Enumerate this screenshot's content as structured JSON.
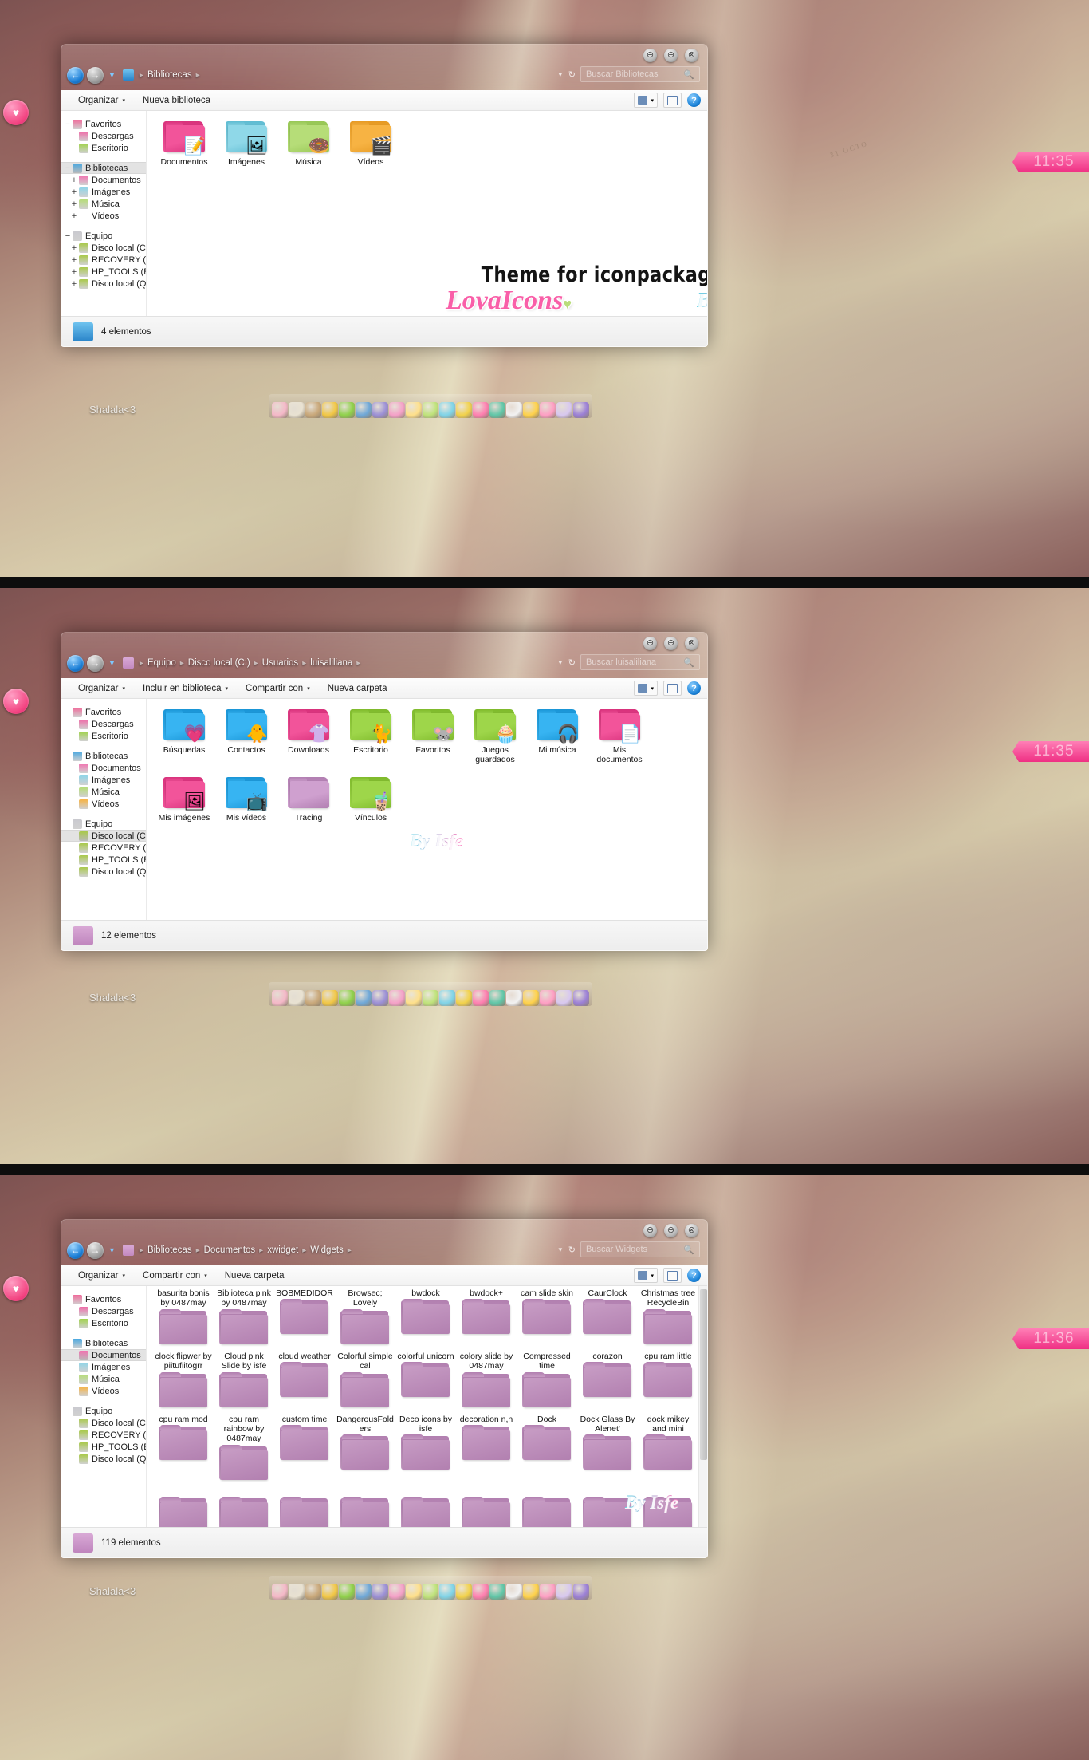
{
  "desktop": {
    "shalala_text": "Shalala<3",
    "heart_icon": "heart-icon",
    "dock_icons": [
      "cake-icon",
      "teacup-icon",
      "tea-box-icon",
      "mushroom-icon",
      "camera-icon",
      "donut-icon",
      "cactus-icon",
      "bear-icon",
      "panda-icon",
      "boot-icon",
      "ice-cream-icon",
      "heart-balloon-icon",
      "bread-icon",
      "smiley-icon",
      "photoshop-icon",
      "mickey-icon",
      "bow-icon",
      "bunny-icon",
      "ball-icon"
    ],
    "wallpaper_note": "31 OCTO"
  },
  "window1": {
    "clock": "11:35",
    "buttons": {
      "minimize": "⊖",
      "maximize": "⊖",
      "close": "⊗"
    },
    "nav": {
      "back": "←",
      "forward": "→",
      "dropdown": "▼"
    },
    "breadcrumb": [
      "Bibliotecas"
    ],
    "breadcrumb_icon": "libraries-icon",
    "search": {
      "placeholder": "Buscar Bibliotecas",
      "icon": "search-icon",
      "refresh": "↻",
      "dropdown": "▼"
    },
    "toolbar": {
      "items": [
        {
          "label": "Organizar",
          "caret": "▾"
        },
        {
          "label": "Nueva biblioteca",
          "caret": ""
        }
      ],
      "view_button": "view-layout-icon",
      "preview_button": "preview-pane-icon",
      "help_button": "?"
    },
    "sidebar": [
      {
        "label": "Favoritos",
        "level": 0,
        "twisty": "−",
        "icon": "minnie-icon",
        "color": "#f06a9a",
        "selected": false
      },
      {
        "label": "Descargas",
        "level": 1,
        "twisty": "",
        "icon": "folder-pink-icon",
        "color": "#ef6ba8",
        "selected": false
      },
      {
        "label": "Escritorio",
        "level": 1,
        "twisty": "",
        "icon": "folder-green-icon",
        "color": "#9fd24a",
        "selected": false
      },
      {
        "label": "Bibliotecas",
        "level": 0,
        "twisty": "−",
        "icon": "libraries-icon",
        "color": "#4aa8e0",
        "selected": true
      },
      {
        "label": "Documentos",
        "level": 1,
        "twisty": "+",
        "icon": "folder-pink-icon",
        "color": "#f272b0",
        "selected": false
      },
      {
        "label": "Imágenes",
        "level": 1,
        "twisty": "+",
        "icon": "folder-blue-icon",
        "color": "#8fd5e8",
        "selected": false
      },
      {
        "label": "Música",
        "level": 1,
        "twisty": "+",
        "icon": "folder-green-icon",
        "color": "#b6dd78",
        "selected": false
      },
      {
        "label": "Vídeos",
        "level": 1,
        "twisty": "+",
        "icon": "folder-orange-icon",
        "color": "#f7b košice"
      },
      {
        "label": "Equipo",
        "level": 0,
        "twisty": "−",
        "icon": "computer-icon",
        "color": "#c9c9cf",
        "selected": false
      },
      {
        "label": "Disco local (C:",
        "level": 1,
        "twisty": "+",
        "icon": "drive-monster-icon",
        "color": "#a9c94a",
        "selected": false
      },
      {
        "label": "RECOVERY (D:",
        "level": 1,
        "twisty": "+",
        "icon": "drive-monster-icon",
        "color": "#a9c94a",
        "selected": false
      },
      {
        "label": "HP_TOOLS (E:",
        "level": 1,
        "twisty": "+",
        "icon": "drive-monster-icon",
        "color": "#a9c94a",
        "selected": false
      },
      {
        "label": "Disco local (Q:",
        "level": 1,
        "twisty": "+",
        "icon": "drive-monster-icon",
        "color": "#a9c94a",
        "selected": false
      }
    ],
    "files": [
      {
        "label": "Documentos",
        "color": "#f2549a",
        "dark": "#d8327c",
        "emblem": "📝"
      },
      {
        "label": "Imágenes",
        "color": "#8fd8e8",
        "dark": "#5fbcd2",
        "emblem": "🖼"
      },
      {
        "label": "Música",
        "color": "#b6dd78",
        "dark": "#97c755",
        "emblem": "🍩"
      },
      {
        "label": "Vídeos",
        "color": "#f7b343",
        "dark": "#e69a24",
        "emblem": "🎬"
      }
    ],
    "overlay": {
      "line1": "Theme for iconpackager",
      "line2": "LovaIcons",
      "line2_heart": "♥",
      "line3": "By Isfe"
    },
    "status": {
      "text": "4 elementos",
      "icon": "libraries-icon"
    }
  },
  "window2": {
    "clock": "11:35",
    "breadcrumb": [
      "Equipo",
      "Disco local (C:)",
      "Usuarios",
      "luisaliliana"
    ],
    "breadcrumb_icon": "folder-lilac-icon",
    "search": {
      "placeholder": "Buscar luisaliliana",
      "icon": "search-icon"
    },
    "toolbar": {
      "items": [
        {
          "label": "Organizar",
          "caret": "▾"
        },
        {
          "label": "Incluir en biblioteca",
          "caret": "▾"
        },
        {
          "label": "Compartir con",
          "caret": "▾"
        },
        {
          "label": "Nueva carpeta",
          "caret": ""
        }
      ]
    },
    "sidebar": [
      {
        "label": "Favoritos",
        "level": 0,
        "twisty": "",
        "icon": "minnie-icon",
        "color": "#f06a9a",
        "selected": false
      },
      {
        "label": "Descargas",
        "level": 1,
        "twisty": "",
        "icon": "folder-pink-icon",
        "color": "#ef6ba8",
        "selected": false
      },
      {
        "label": "Escritorio",
        "level": 1,
        "twisty": "",
        "icon": "folder-green-icon",
        "color": "#9fd24a",
        "selected": false
      },
      {
        "label": "Bibliotecas",
        "level": 0,
        "twisty": "",
        "icon": "libraries-icon",
        "color": "#4aa8e0",
        "selected": false
      },
      {
        "label": "Documentos",
        "level": 1,
        "twisty": "",
        "icon": "folder-pink-icon",
        "color": "#f272b0",
        "selected": false
      },
      {
        "label": "Imágenes",
        "level": 1,
        "twisty": "",
        "icon": "folder-blue-icon",
        "color": "#8fd5e8",
        "selected": false
      },
      {
        "label": "Música",
        "level": 1,
        "twisty": "",
        "icon": "folder-green-icon",
        "color": "#b6dd78",
        "selected": false
      },
      {
        "label": "Vídeos",
        "level": 1,
        "twisty": "",
        "icon": "folder-orange-icon",
        "color": "#f7b343",
        "selected": false
      },
      {
        "label": "Equipo",
        "level": 0,
        "twisty": "",
        "icon": "computer-icon",
        "color": "#c9c9cf",
        "selected": false
      },
      {
        "label": "Disco local (C:",
        "level": 1,
        "twisty": "",
        "icon": "drive-monster-icon",
        "color": "#a9c94a",
        "selected": true
      },
      {
        "label": "RECOVERY (D:",
        "level": 1,
        "twisty": "",
        "icon": "drive-monster-icon",
        "color": "#a9c94a",
        "selected": false
      },
      {
        "label": "HP_TOOLS (E:",
        "level": 1,
        "twisty": "",
        "icon": "drive-monster-icon",
        "color": "#a9c94a",
        "selected": false
      },
      {
        "label": "Disco local (Q:",
        "level": 1,
        "twisty": "",
        "icon": "drive-monster-icon",
        "color": "#a9c94a",
        "selected": false
      }
    ],
    "files": [
      {
        "label": "Búsquedas",
        "color": "#37b4f2",
        "dark": "#1a95d6",
        "emblem": "💗"
      },
      {
        "label": "Contactos",
        "color": "#37b4f2",
        "dark": "#1a95d6",
        "emblem": "🐥"
      },
      {
        "label": "Downloads",
        "color": "#f2549a",
        "dark": "#d8327c",
        "emblem": "👚"
      },
      {
        "label": "Escritorio",
        "color": "#9ed64a",
        "dark": "#7fba2c",
        "emblem": "🐈"
      },
      {
        "label": "Favoritos",
        "color": "#9ed64a",
        "dark": "#7fba2c",
        "emblem": "🐭"
      },
      {
        "label": "Juegos guardados",
        "color": "#9ed64a",
        "dark": "#7fba2c",
        "emblem": "🧁"
      },
      {
        "label": "Mi música",
        "color": "#37b4f2",
        "dark": "#1a95d6",
        "emblem": "🎧"
      },
      {
        "label": "Mis documentos",
        "color": "#f2549a",
        "dark": "#d8327c",
        "emblem": "📄"
      },
      {
        "label": "Mis imágenes",
        "color": "#f2549a",
        "dark": "#d8327c",
        "emblem": "🖼"
      },
      {
        "label": "Mis vídeos",
        "color": "#37b4f2",
        "dark": "#1a95d6",
        "emblem": "📺"
      },
      {
        "label": "Tracing",
        "color": "#cfa0cf",
        "dark": "#b27fb2",
        "emblem": ""
      },
      {
        "label": "Vínculos",
        "color": "#9ed64a",
        "dark": "#7fba2c",
        "emblem": "🧋"
      }
    ],
    "overlay": {
      "line3": "By Isfe"
    },
    "status": {
      "text": "12 elementos",
      "icon": "folder-lilac-icon"
    }
  },
  "window3": {
    "clock": "11:36",
    "breadcrumb": [
      "Bibliotecas",
      "Documentos",
      "xwidget",
      "Widgets"
    ],
    "breadcrumb_icon": "folder-lilac-icon",
    "search": {
      "placeholder": "Buscar Widgets",
      "icon": "search-icon"
    },
    "toolbar": {
      "items": [
        {
          "label": "Organizar",
          "caret": "▾"
        },
        {
          "label": "Compartir con",
          "caret": "▾"
        },
        {
          "label": "Nueva carpeta",
          "caret": ""
        }
      ]
    },
    "sidebar": [
      {
        "label": "Favoritos",
        "level": 0,
        "twisty": "",
        "icon": "minnie-icon",
        "color": "#f06a9a",
        "selected": false
      },
      {
        "label": "Descargas",
        "level": 1,
        "twisty": "",
        "icon": "folder-pink-icon",
        "color": "#ef6ba8",
        "selected": false
      },
      {
        "label": "Escritorio",
        "level": 1,
        "twisty": "",
        "icon": "folder-green-icon",
        "color": "#9fd24a",
        "selected": false
      },
      {
        "label": "Bibliotecas",
        "level": 0,
        "twisty": "",
        "icon": "libraries-icon",
        "color": "#4aa8e0",
        "selected": false
      },
      {
        "label": "Documentos",
        "level": 1,
        "twisty": "",
        "icon": "folder-pink-icon",
        "color": "#f272b0",
        "selected": true
      },
      {
        "label": "Imágenes",
        "level": 1,
        "twisty": "",
        "icon": "folder-blue-icon",
        "color": "#8fd5e8",
        "selected": false
      },
      {
        "label": "Música",
        "level": 1,
        "twisty": "",
        "icon": "folder-green-icon",
        "color": "#b6dd78",
        "selected": false
      },
      {
        "label": "Vídeos",
        "level": 1,
        "twisty": "",
        "icon": "folder-orange-icon",
        "color": "#f7b343",
        "selected": false
      },
      {
        "label": "Equipo",
        "level": 0,
        "twisty": "",
        "icon": "computer-icon",
        "color": "#c9c9cf",
        "selected": false
      },
      {
        "label": "Disco local (C:",
        "level": 1,
        "twisty": "",
        "icon": "drive-monster-icon",
        "color": "#a9c94a",
        "selected": false
      },
      {
        "label": "RECOVERY (D:",
        "level": 1,
        "twisty": "",
        "icon": "drive-monster-icon",
        "color": "#a9c94a",
        "selected": false
      },
      {
        "label": "HP_TOOLS (E:",
        "level": 1,
        "twisty": "",
        "icon": "drive-monster-icon",
        "color": "#a9c94a",
        "selected": false
      },
      {
        "label": "Disco local (Q:",
        "level": 1,
        "twisty": "",
        "icon": "drive-monster-icon",
        "color": "#a9c94a",
        "selected": false
      }
    ],
    "files": [
      {
        "label": "basurita bonis by 0487may"
      },
      {
        "label": "Biblioteca pink by 0487may"
      },
      {
        "label": "BOBMEDIDOR"
      },
      {
        "label": "Browsec; Lovely"
      },
      {
        "label": "bwdock"
      },
      {
        "label": "bwdock+"
      },
      {
        "label": "cam slide skin"
      },
      {
        "label": "CaurClock"
      },
      {
        "label": "Christmas tree RecycleBin"
      },
      {
        "label": "clock flipwer by piitufiitogrr"
      },
      {
        "label": "Cloud pink Slide by isfe"
      },
      {
        "label": "cloud weather"
      },
      {
        "label": "Colorful simple cal"
      },
      {
        "label": "colorful unicorn"
      },
      {
        "label": "colory slide by 0487may"
      },
      {
        "label": "Compressed time"
      },
      {
        "label": "corazon"
      },
      {
        "label": "cpu ram little"
      },
      {
        "label": "cpu ram mod"
      },
      {
        "label": "cpu ram rainbow by 0487may"
      },
      {
        "label": "custom time"
      },
      {
        "label": "DangerousFolders"
      },
      {
        "label": "Deco icons by isfe"
      },
      {
        "label": "decoration n,n"
      },
      {
        "label": "Dock"
      },
      {
        "label": "Dock Glass By Alenet'"
      },
      {
        "label": "dock mikey and mini"
      },
      {
        "label": ""
      },
      {
        "label": ""
      },
      {
        "label": ""
      },
      {
        "label": ""
      },
      {
        "label": ""
      },
      {
        "label": ""
      },
      {
        "label": ""
      },
      {
        "label": ""
      },
      {
        "label": ""
      }
    ],
    "file_color": "#c79cc4",
    "file_dark": "#b280b0",
    "overlay": {
      "line3": "By Isfe"
    },
    "status": {
      "text": "119 elementos",
      "icon": "folder-lilac-icon"
    }
  }
}
